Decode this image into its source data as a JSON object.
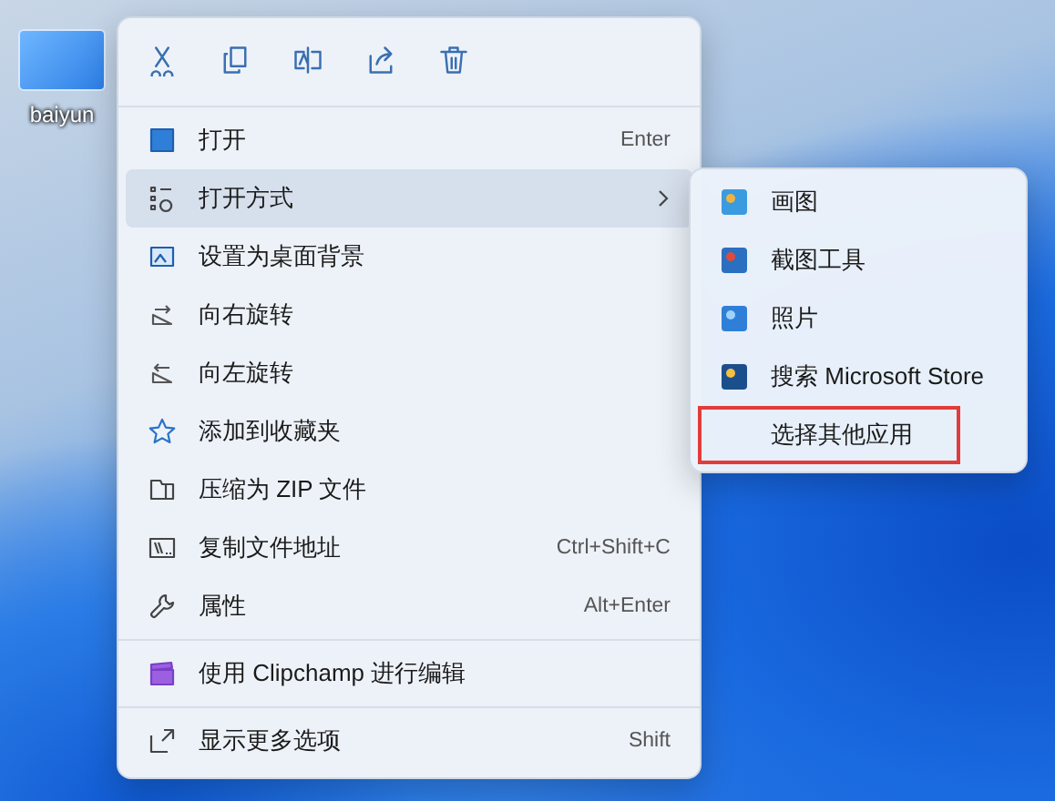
{
  "desktop_icon": {
    "label": "baiyun"
  },
  "context_menu": {
    "items": [
      {
        "kind": "item",
        "label": "打开",
        "shortcut": "Enter",
        "submenu": false,
        "highlighted": false
      },
      {
        "kind": "item",
        "label": "打开方式",
        "submenu": true,
        "highlighted": true
      },
      {
        "kind": "item",
        "label": "设置为桌面背景",
        "submenu": false,
        "highlighted": false
      },
      {
        "kind": "item",
        "label": "向右旋转",
        "submenu": false,
        "highlighted": false
      },
      {
        "kind": "item",
        "label": "向左旋转",
        "submenu": false,
        "highlighted": false
      },
      {
        "kind": "item",
        "label": "添加到收藏夹",
        "submenu": false,
        "highlighted": false
      },
      {
        "kind": "item",
        "label": "压缩为 ZIP 文件",
        "submenu": false,
        "highlighted": false
      },
      {
        "kind": "item",
        "label": "复制文件地址",
        "shortcut": "Ctrl+Shift+C",
        "submenu": false,
        "highlighted": false
      },
      {
        "kind": "item",
        "label": "属性",
        "shortcut": "Alt+Enter",
        "submenu": false,
        "highlighted": false
      },
      {
        "kind": "separator"
      },
      {
        "kind": "item",
        "label": "使用 Clipchamp 进行编辑",
        "submenu": false,
        "highlighted": false
      },
      {
        "kind": "separator"
      },
      {
        "kind": "item",
        "label": "显示更多选项",
        "shortcut": "Shift",
        "submenu": false,
        "highlighted": false
      }
    ]
  },
  "submenu": {
    "items": [
      {
        "label": "画图",
        "selected": false
      },
      {
        "label": "截图工具",
        "selected": false
      },
      {
        "label": "照片",
        "selected": false
      },
      {
        "label": "搜索 Microsoft Store",
        "selected": false
      },
      {
        "label": "选择其他应用",
        "selected": true
      }
    ]
  }
}
